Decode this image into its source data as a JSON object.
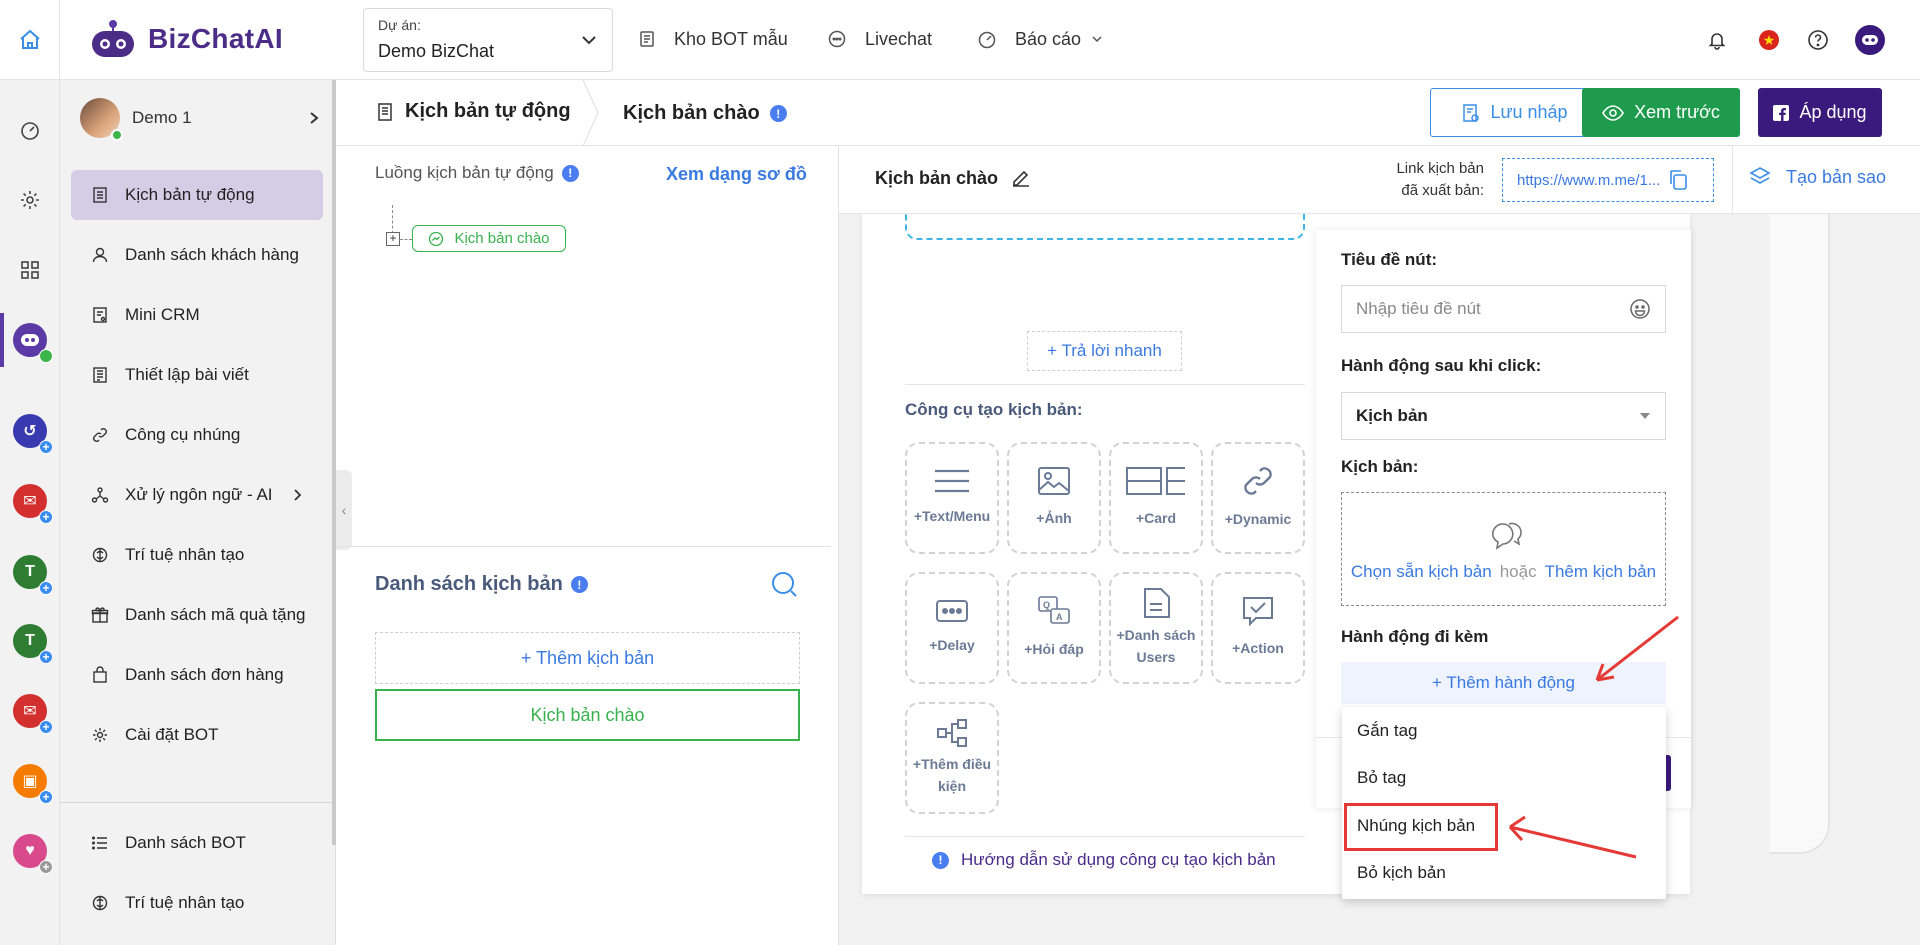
{
  "topbar": {
    "brand": "BizChatAI",
    "project_label": "Dự án:",
    "project_value": "Demo BizChat",
    "nav": [
      "Kho BOT mẫu",
      "Livechat",
      "Báo cáo"
    ],
    "icons": [
      "home-icon",
      "bell-icon",
      "vietnam-flag-icon",
      "help-icon",
      "avatar-icon"
    ]
  },
  "sidebar": {
    "user_name": "Demo 1",
    "items": [
      {
        "label": "Kịch bản tự động",
        "icon": "script-icon",
        "active": true
      },
      {
        "label": "Danh sách khách hàng",
        "icon": "user-icon"
      },
      {
        "label": "Mini CRM",
        "icon": "crm-icon"
      },
      {
        "label": "Thiết lập bài viết",
        "icon": "post-icon"
      },
      {
        "label": "Công cụ nhúng",
        "icon": "link-icon"
      },
      {
        "label": "Xử lý ngôn ngữ - AI",
        "icon": "nlp-icon",
        "has_submenu": true
      },
      {
        "label": "Trí tuệ nhân tạo",
        "icon": "ai-icon"
      },
      {
        "label": "Danh sách mã quà tặng",
        "icon": "gift-icon"
      },
      {
        "label": "Danh sách đơn hàng",
        "icon": "bag-icon"
      },
      {
        "label": "Cài đặt BOT",
        "icon": "gear-icon"
      }
    ],
    "bottom_items": [
      {
        "label": "Danh sách BOT",
        "icon": "list-icon"
      },
      {
        "label": "Trí tuệ nhân tạo",
        "icon": "ai-icon"
      }
    ]
  },
  "header": {
    "crumb1": "Kịch bản tự động",
    "crumb2": "Kịch bản chào",
    "btn_draft": "Lưu nháp",
    "btn_preview": "Xem trước",
    "btn_apply": "Áp dụng"
  },
  "flow": {
    "title": "Luồng kịch bản tự động",
    "map_link": "Xem dạng sơ đồ",
    "node": "Kịch bản chào",
    "list_title": "Danh sách kịch bản",
    "list_add": "+ Thêm kịch bản",
    "list_item": "Kịch bản chào"
  },
  "editor": {
    "title": "Kịch bản chào",
    "link_label_1": "Link kịch bản",
    "link_label_2": "đã xuất bản:",
    "link_value": "https://www.m.me/1...",
    "copy_script": "Tạo bản sao",
    "quick_reply": "+ Trả lời nhanh",
    "tools_title": "Công cụ tạo kịch bản:",
    "tools": [
      {
        "line1": "+Text/Menu",
        "line2": "",
        "icon": "text-menu-icon"
      },
      {
        "line1": "+Ảnh",
        "line2": "",
        "icon": "image-icon"
      },
      {
        "line1": "+Card",
        "line2": "",
        "icon": "card-icon"
      },
      {
        "line1": "+Dynamic",
        "line2": "",
        "icon": "dynamic-link-icon"
      },
      {
        "line1": "+Delay",
        "line2": "",
        "icon": "delay-icon"
      },
      {
        "line1": "+Hỏi đáp",
        "line2": "",
        "icon": "qa-icon"
      },
      {
        "line1": "+Danh sách",
        "line2": "Users",
        "icon": "user-list-icon"
      },
      {
        "line1": "+Action",
        "line2": "",
        "icon": "action-icon"
      },
      {
        "line1": "+Thêm điều",
        "line2": "kiện",
        "icon": "condition-icon"
      }
    ],
    "guide": "Hướng dẫn sử dụng công cụ tạo kịch bản"
  },
  "button_panel": {
    "title_label": "Tiêu đề nút:",
    "title_placeholder": "Nhập tiêu đề nút",
    "action_label": "Hành động sau khi click:",
    "action_value": "Kịch bản",
    "script_label": "Kịch bản:",
    "choose_script": "Chọn sẵn kịch bản",
    "or": "hoặc",
    "add_script": "Thêm kịch bản",
    "attached_label": "Hành động đi kèm",
    "add_action": "+ Thêm hành động"
  },
  "dropdown": {
    "items": [
      "Gắn tag",
      "Bỏ tag",
      "Nhúng kịch bản",
      "Bỏ kịch bản"
    ],
    "highlighted": "Nhúng kịch bản"
  },
  "colors": {
    "brand": "#4b2c86",
    "primary_blue": "#3a7ae0",
    "success_green": "#1f9b4e",
    "apply_purple": "#3a1a7c",
    "annotation_red": "#e53935",
    "active_sidebar": "#d5cde5"
  }
}
